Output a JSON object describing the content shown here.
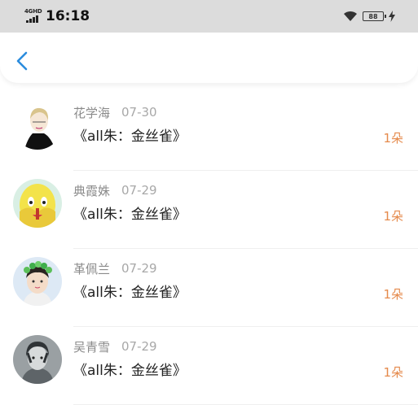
{
  "status_bar": {
    "network": "4GHD",
    "time": "16:18",
    "battery": "88"
  },
  "nav": {
    "back_icon": "chevron-left-icon"
  },
  "colors": {
    "accent": "#2b8cde",
    "count": "#e58a4c"
  },
  "items": [
    {
      "name": "花学海",
      "date": "07-30",
      "title": "《all朱：金丝雀》",
      "count": "1朵",
      "avatar": "illustrated-person-avatar"
    },
    {
      "name": "典霞姝",
      "date": "07-29",
      "title": "《all朱：金丝雀》",
      "count": "1朵",
      "avatar": "yellow-character-avatar"
    },
    {
      "name": "革佩兰",
      "date": "07-29",
      "title": "《all朱：金丝雀》",
      "count": "1朵",
      "avatar": "flower-crown-avatar"
    },
    {
      "name": "吴青雪",
      "date": "07-29",
      "title": "《all朱：金丝雀》",
      "count": "1朵",
      "avatar": "grey-portrait-avatar"
    }
  ]
}
